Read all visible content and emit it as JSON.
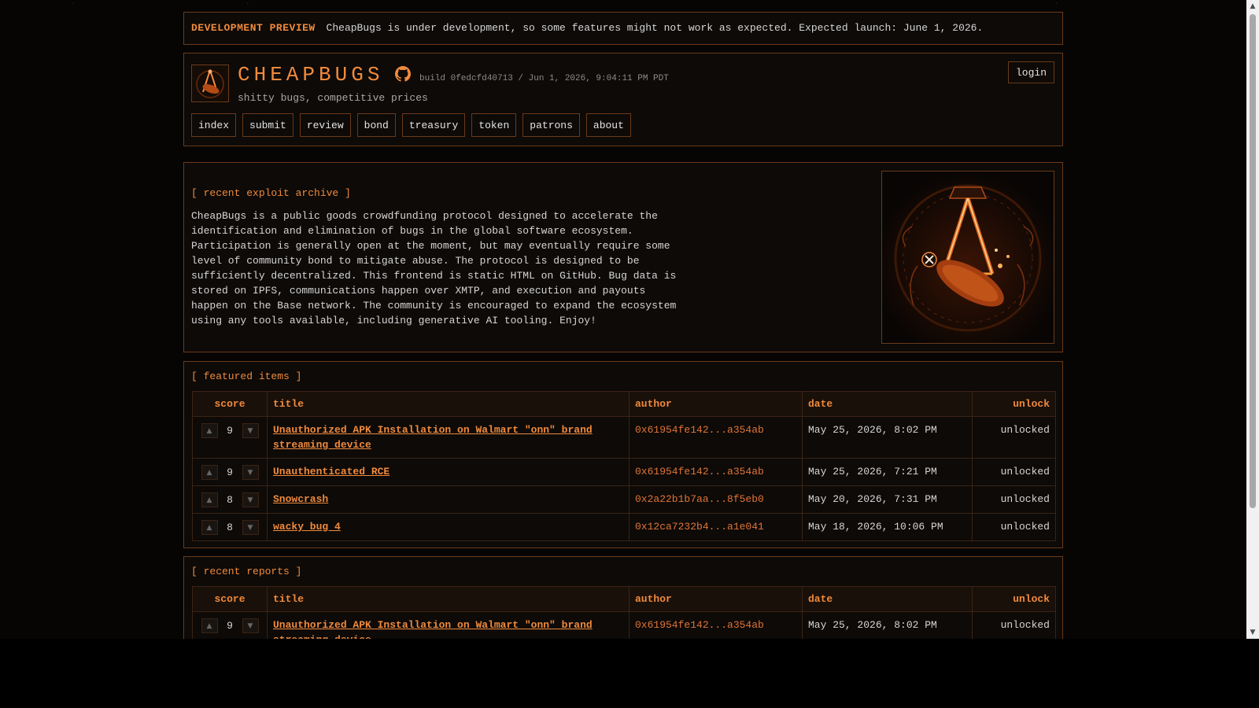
{
  "banner": {
    "tag": "DEVELOPMENT PREVIEW",
    "message": "CheapBugs is under development, so some features might not work as expected. Expected launch: June 1, 2026."
  },
  "header": {
    "brand": "CHEAPBUGS",
    "build": "build 0fedcfd40713 / Jun 1, 2026, 9:04:11 PM PDT",
    "tagline": "shitty bugs, competitive prices",
    "login_label": "login",
    "nav": [
      "index",
      "submit",
      "review",
      "bond",
      "treasury",
      "token",
      "patrons",
      "about"
    ]
  },
  "intro": {
    "title": "[ recent exploit archive ]",
    "text": "CheapBugs is a public goods crowdfunding protocol designed to accelerate the identification and elimination of bugs in the global software ecosystem. Participation is generally open at the moment, but may eventually require some level of community bond to mitigate abuse. The protocol is designed to be sufficiently decentralized. This frontend is static HTML on GitHub. Bug data is stored on IPFS, communications happen over XMTP, and execution and payouts happen on the Base network. The community is encouraged to expand the ecosystem using any tools available, including generative AI tooling. Enjoy!"
  },
  "columns": {
    "score": "score",
    "title": "title",
    "author": "author",
    "date": "date",
    "unlock": "unlock"
  },
  "featured": {
    "title": "[ featured items ]",
    "rows": [
      {
        "score": "9",
        "title": "Unauthorized APK Installation on Walmart \"onn\" brand streaming device",
        "author": "0x61954fe142...a354ab",
        "date": "May 25, 2026, 8:02 PM",
        "unlock": "unlocked"
      },
      {
        "score": "9",
        "title": "Unauthenticated RCE",
        "author": "0x61954fe142...a354ab",
        "date": "May 25, 2026, 7:21 PM",
        "unlock": "unlocked"
      },
      {
        "score": "8",
        "title": "Snowcrash",
        "author": "0x2a22b1b7aa...8f5eb0",
        "date": "May 20, 2026, 7:31 PM",
        "unlock": "unlocked"
      },
      {
        "score": "8",
        "title": "wacky bug 4",
        "author": "0x12ca7232b4...a1e041",
        "date": "May 18, 2026, 10:06 PM",
        "unlock": "unlocked"
      }
    ]
  },
  "recent": {
    "title": "[ recent reports ]",
    "rows": [
      {
        "score": "9",
        "title": "Unauthorized APK Installation on Walmart \"onn\" brand streaming device",
        "author": "0x61954fe142...a354ab",
        "date": "May 25, 2026, 8:02 PM",
        "unlock": "unlocked"
      }
    ]
  },
  "icons": {
    "upvote": "up-arrow-icon",
    "downvote": "down-arrow-icon",
    "github": "github-icon"
  },
  "colors": {
    "accent": "#f08a3c",
    "border": "#6a3a18",
    "background": "#060504"
  }
}
